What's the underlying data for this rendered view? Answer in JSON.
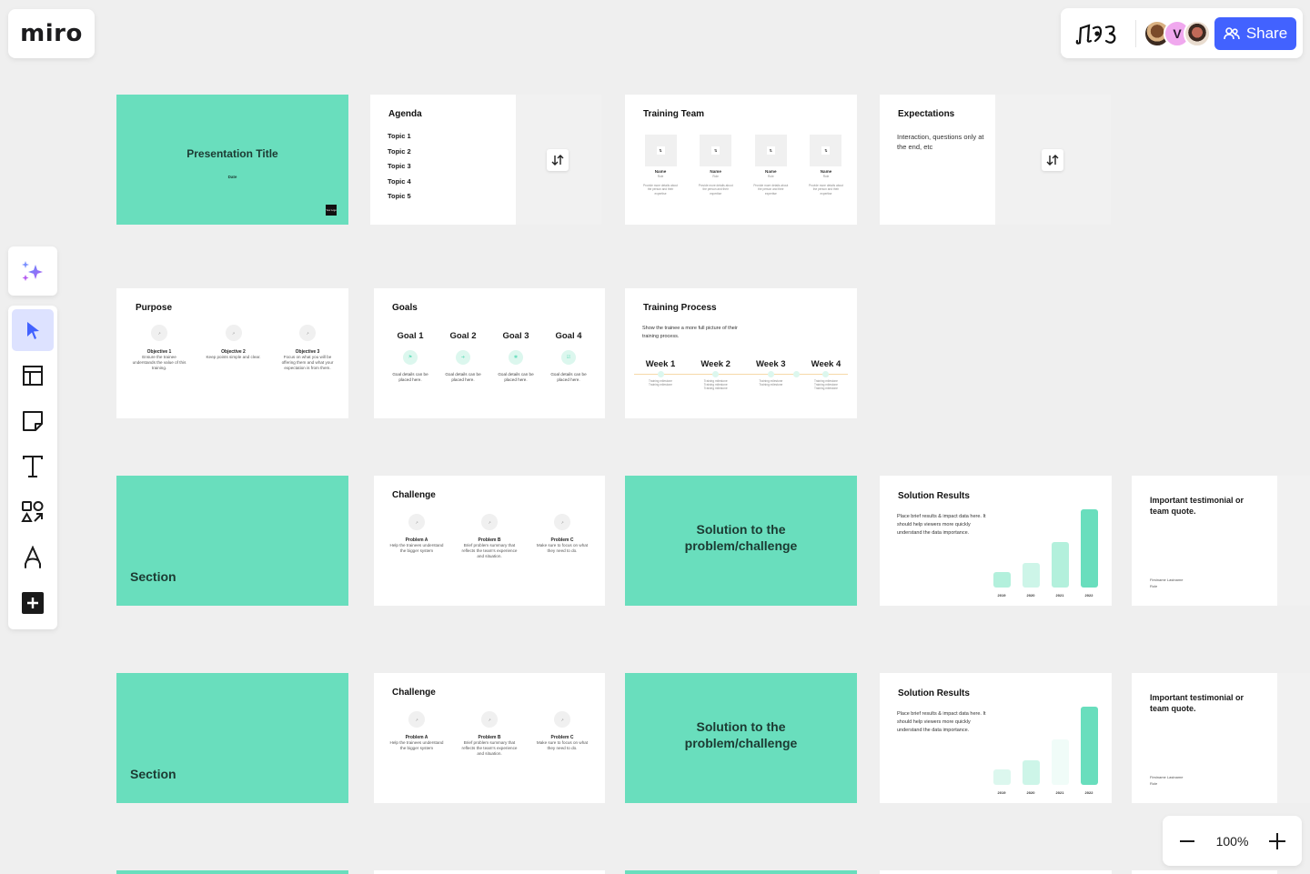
{
  "app": {
    "logo": "miro",
    "share_label": "Share",
    "collaborators": [
      {
        "name": "collaborator-1",
        "initial": ""
      },
      {
        "name": "collaborator-2",
        "initial": "V"
      },
      {
        "name": "collaborator-3",
        "initial": ""
      }
    ],
    "zoom_level": "100%",
    "zoom_out_label": "−",
    "zoom_in_label": "+",
    "accent_color": "#4262ff",
    "frame_green": "#69debd"
  },
  "toolbar": {
    "tools": [
      {
        "id": "select",
        "icon": "cursor-icon",
        "active": true
      },
      {
        "id": "templates",
        "icon": "templates-icon"
      },
      {
        "id": "sticky-note",
        "icon": "sticky-note-icon"
      },
      {
        "id": "text",
        "icon": "text-icon"
      },
      {
        "id": "shapes",
        "icon": "shapes-icon"
      },
      {
        "id": "pen",
        "icon": "pen-icon"
      },
      {
        "id": "more",
        "icon": "plus-icon"
      }
    ]
  },
  "frames": {
    "title": {
      "heading": "Presentation Title",
      "date": "Date",
      "logo": "Your Logo"
    },
    "agenda": {
      "heading": "Agenda",
      "topics": [
        "Topic 1",
        "Topic 2",
        "Topic 3",
        "Topic 4",
        "Topic 5"
      ]
    },
    "team": {
      "heading": "Training Team",
      "members": [
        {
          "name": "Name",
          "role": "Role",
          "desc": "Provide more details about the person and their expertise"
        },
        {
          "name": "Name",
          "role": "Role",
          "desc": "Provide more details about the person and their expertise"
        },
        {
          "name": "Name",
          "role": "Role",
          "desc": "Provide more details about the person and their expertise"
        },
        {
          "name": "Name",
          "role": "Role",
          "desc": "Provide more details about the person and their expertise"
        }
      ]
    },
    "expectations": {
      "heading": "Expectations",
      "body": "Interaction, questions only at the end, etc"
    },
    "purpose": {
      "heading": "Purpose",
      "items": [
        {
          "title": "Objective 1",
          "desc": "Ensure the trainee understands the value of this training."
        },
        {
          "title": "Objective 2",
          "desc": "Keep points simple and clear."
        },
        {
          "title": "Objective 3",
          "desc": "Focus on what you will be offering them and what your expectation is from them."
        }
      ]
    },
    "goals": {
      "heading": "Goals",
      "items": [
        {
          "title": "Goal 1",
          "desc": "Goal details can be placed here."
        },
        {
          "title": "Goal 2",
          "desc": "Goal details can be placed here."
        },
        {
          "title": "Goal 3",
          "desc": "Goal details can be placed here."
        },
        {
          "title": "Goal 4",
          "desc": "Goal details can be placed here."
        }
      ]
    },
    "process": {
      "heading": "Training Process",
      "body": "Show the trainee a more full picture of their training process.",
      "weeks": [
        {
          "title": "Week 1",
          "milestones": [
            "Training milestone",
            "Training milestone"
          ]
        },
        {
          "title": "Week 2",
          "milestones": [
            "Training milestone",
            "Training milestone",
            "Training milestone"
          ]
        },
        {
          "title": "Week 3",
          "milestones": [
            "Training milestone",
            "Training milestone"
          ]
        },
        {
          "title": "Week 4",
          "milestones": [
            "Training milestone",
            "Training milestone",
            "Training milestone"
          ]
        }
      ]
    },
    "section": {
      "heading": "Section"
    },
    "challenge": {
      "heading": "Challenge",
      "items": [
        {
          "title": "Problem A",
          "desc": "Help the trainees understand the bigger system"
        },
        {
          "title": "Problem B",
          "desc": "Brief problem summary that reflects the team's experience and situation."
        },
        {
          "title": "Problem C",
          "desc": "Make sure to focus on what they need to do."
        }
      ]
    },
    "solution": {
      "heading": "Solution to the problem/challenge"
    },
    "results": {
      "heading": "Solution Results",
      "body": "Place brief results & impact data here. It should help viewers more quickly understand the data importance.",
      "years": [
        "2019",
        "2020",
        "2021",
        "2022"
      ],
      "values_row1": [
        0.2,
        0.31,
        0.58,
        1.0
      ],
      "values_row2": [
        0.2,
        0.31,
        0.58,
        1.0
      ]
    },
    "testimonial": {
      "quote": "Important testimonial or team quote.",
      "author": "Firstname Lastname",
      "role": "Role"
    }
  }
}
